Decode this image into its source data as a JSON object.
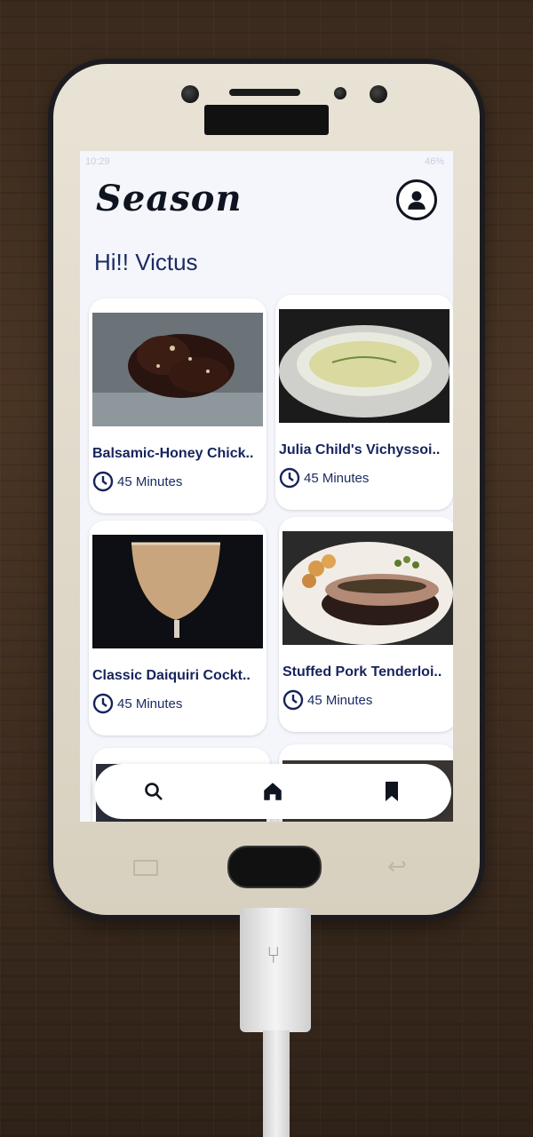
{
  "app": {
    "name": "Season"
  },
  "status_bar": {
    "time": "10:29",
    "battery": "46%"
  },
  "header": {
    "greeting": "Hi!! Victus"
  },
  "recipes": [
    {
      "title": "Balsamic-Honey Chick..",
      "time": "45 Minutes",
      "image": "fried-chicken-photo"
    },
    {
      "title": "Julia Child's Vichyssoi..",
      "time": "45 Minutes",
      "image": "soup-photo"
    },
    {
      "title": "Classic Daiquiri Cockt..",
      "time": "45 Minutes",
      "image": "cocktail-photo"
    },
    {
      "title": "Stuffed Pork Tenderloi..",
      "time": "45 Minutes",
      "image": "pork-photo"
    }
  ],
  "nav": {
    "items": [
      "search-icon",
      "home-icon",
      "bookmark-icon"
    ]
  },
  "colors": {
    "accent": "#1b2b63",
    "title": "#16235c",
    "background": "#f4f6fb"
  }
}
